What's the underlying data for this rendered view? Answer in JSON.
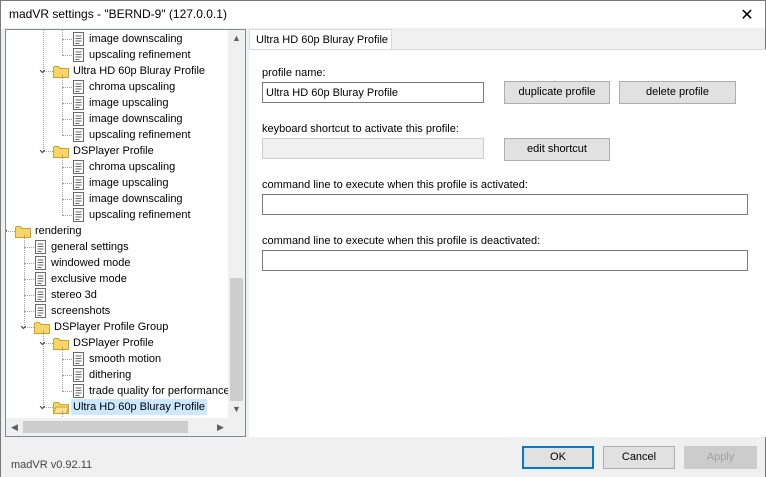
{
  "window": {
    "title": "madVR settings - \"BERND-9\" (127.0.0.1)",
    "close_glyph": "✕"
  },
  "tree": {
    "rows": [
      {
        "label": "image downscaling",
        "type": "page",
        "level": 4
      },
      {
        "label": "upscaling refinement",
        "type": "page",
        "level": 4
      },
      {
        "label": "Ultra HD 60p Bluray Profile",
        "type": "folder",
        "level": 3,
        "expanded": true
      },
      {
        "label": "chroma upscaling",
        "type": "page",
        "level": 4
      },
      {
        "label": "image upscaling",
        "type": "page",
        "level": 4
      },
      {
        "label": "image downscaling",
        "type": "page",
        "level": 4
      },
      {
        "label": "upscaling refinement",
        "type": "page",
        "level": 4
      },
      {
        "label": "DSPlayer Profile",
        "type": "folder",
        "level": 3,
        "expanded": true
      },
      {
        "label": "chroma upscaling",
        "type": "page",
        "level": 4
      },
      {
        "label": "image upscaling",
        "type": "page",
        "level": 4
      },
      {
        "label": "image downscaling",
        "type": "page",
        "level": 4
      },
      {
        "label": "upscaling refinement",
        "type": "page",
        "level": 4
      },
      {
        "label": "rendering",
        "type": "folder",
        "level": 1,
        "expanded": true
      },
      {
        "label": "general settings",
        "type": "page",
        "level": 2
      },
      {
        "label": "windowed mode",
        "type": "page",
        "level": 2
      },
      {
        "label": "exclusive mode",
        "type": "page",
        "level": 2
      },
      {
        "label": "stereo 3d",
        "type": "page",
        "level": 2
      },
      {
        "label": "screenshots",
        "type": "page",
        "level": 2
      },
      {
        "label": "DSPlayer Profile Group",
        "type": "folder",
        "level": 2,
        "expanded": true
      },
      {
        "label": "DSPlayer Profile",
        "type": "folder",
        "level": 3,
        "expanded": true
      },
      {
        "label": "smooth motion",
        "type": "page",
        "level": 4
      },
      {
        "label": "dithering",
        "type": "page",
        "level": 4
      },
      {
        "label": "trade quality for performance",
        "type": "page",
        "level": 4
      },
      {
        "label": "Ultra HD 60p Bluray Profile",
        "type": "folder-open",
        "level": 3,
        "expanded": true,
        "selected": true
      }
    ]
  },
  "tab": {
    "label": "Ultra HD 60p Bluray Profile"
  },
  "form": {
    "profile_name_label": "profile name:",
    "profile_name_value": "Ultra HD 60p Bluray Profile",
    "duplicate_label": "duplicate profile",
    "delete_label": "delete profile",
    "shortcut_label": "keyboard shortcut to activate this profile:",
    "shortcut_value": "",
    "edit_shortcut_label": "edit shortcut",
    "cmd_activate_label": "command line to execute when this profile is activated:",
    "cmd_activate_value": "",
    "cmd_deactivate_label": "command line to execute when this profile is deactivated:",
    "cmd_deactivate_value": ""
  },
  "footer": {
    "version": "madVR v0.92.11",
    "ok_label": "OK",
    "cancel_label": "Cancel",
    "apply_label": "Apply"
  }
}
